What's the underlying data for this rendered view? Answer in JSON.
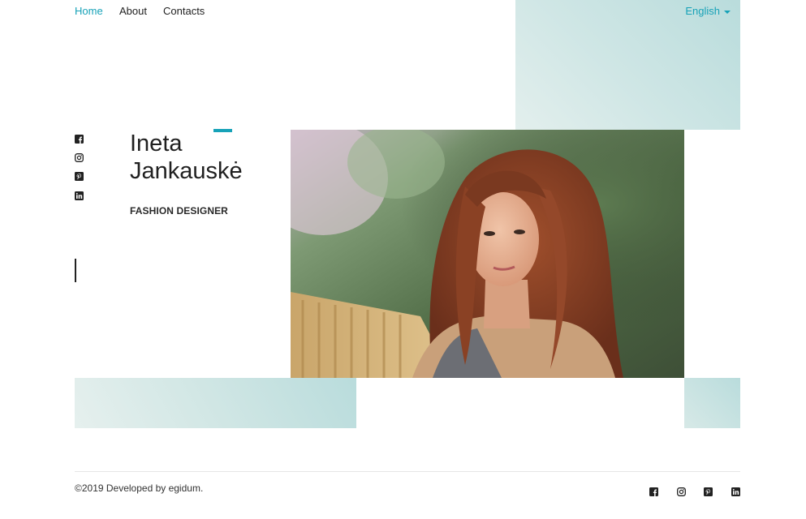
{
  "nav": {
    "items": [
      {
        "label": "Home",
        "active": true
      },
      {
        "label": "About",
        "active": false
      },
      {
        "label": "Contacts",
        "active": false
      }
    ],
    "language": "English"
  },
  "social": [
    {
      "icon": "facebook-icon"
    },
    {
      "icon": "instagram-icon"
    },
    {
      "icon": "pinterest-icon"
    },
    {
      "icon": "linkedin-icon"
    }
  ],
  "hero": {
    "first_name": "Ineta",
    "last_name": "Jankauskė",
    "role": "FASHION DESIGNER"
  },
  "footer": {
    "copyright": "©2019 Developed by egidum."
  },
  "colors": {
    "accent": "#17a2b8",
    "gradient": "#b9dcdc"
  }
}
